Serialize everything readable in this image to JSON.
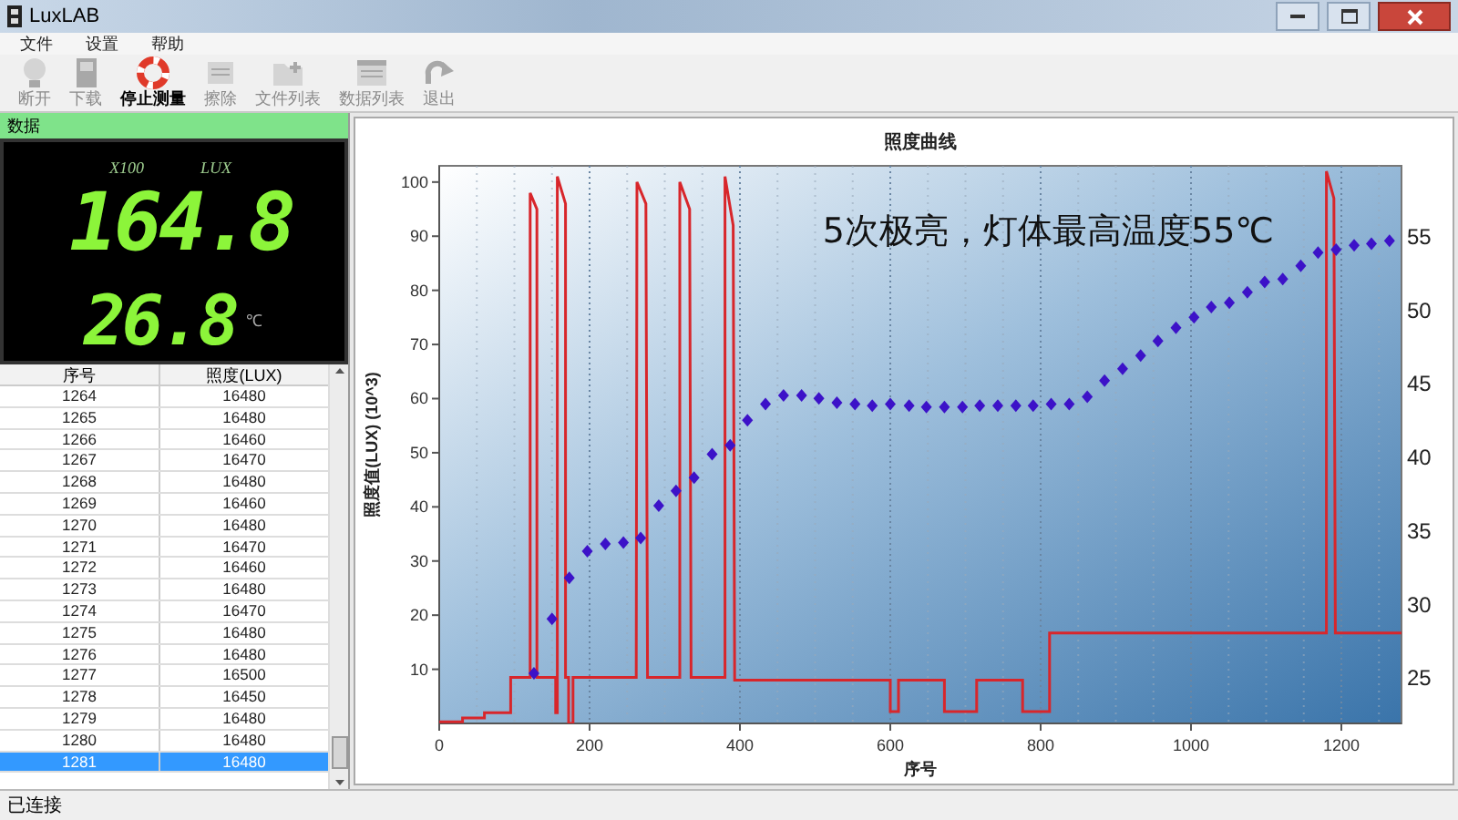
{
  "window": {
    "title": "LuxLAB"
  },
  "menu": [
    "文件",
    "设置",
    "帮助"
  ],
  "toolbar": [
    {
      "label": "断开",
      "disabled": true
    },
    {
      "label": "下载",
      "disabled": true
    },
    {
      "label": "停止测量",
      "disabled": false
    },
    {
      "label": "擦除",
      "disabled": true
    },
    {
      "label": "文件列表",
      "disabled": true
    },
    {
      "label": "数据列表",
      "disabled": true
    },
    {
      "label": "退出",
      "disabled": true
    }
  ],
  "data_panel": {
    "title": "数据",
    "display": {
      "multiplier": "X100",
      "unit": "LUX",
      "lux": "164.8",
      "temperature": "26.8",
      "temperature_unit": "℃"
    },
    "table": {
      "columns": [
        "序号",
        "照度(LUX)"
      ],
      "rows": [
        {
          "cells": [
            "1264",
            "16480"
          ],
          "selected": false
        },
        {
          "cells": [
            "1265",
            "16480"
          ],
          "selected": false
        },
        {
          "cells": [
            "1266",
            "16460"
          ],
          "selected": false
        },
        {
          "cells": [
            "1267",
            "16470"
          ],
          "selected": false
        },
        {
          "cells": [
            "1268",
            "16480"
          ],
          "selected": false
        },
        {
          "cells": [
            "1269",
            "16460"
          ],
          "selected": false
        },
        {
          "cells": [
            "1270",
            "16480"
          ],
          "selected": false
        },
        {
          "cells": [
            "1271",
            "16470"
          ],
          "selected": false
        },
        {
          "cells": [
            "1272",
            "16460"
          ],
          "selected": false
        },
        {
          "cells": [
            "1273",
            "16480"
          ],
          "selected": false
        },
        {
          "cells": [
            "1274",
            "16470"
          ],
          "selected": false
        },
        {
          "cells": [
            "1275",
            "16480"
          ],
          "selected": false
        },
        {
          "cells": [
            "1276",
            "16480"
          ],
          "selected": false
        },
        {
          "cells": [
            "1277",
            "16500"
          ],
          "selected": false
        },
        {
          "cells": [
            "1278",
            "16450"
          ],
          "selected": false
        },
        {
          "cells": [
            "1279",
            "16480"
          ],
          "selected": false
        },
        {
          "cells": [
            "1280",
            "16480"
          ],
          "selected": false
        },
        {
          "cells": [
            "1281",
            "16480"
          ],
          "selected": true
        }
      ]
    }
  },
  "chart_panel": {
    "chart_data": {
      "type": "line",
      "title": "照度曲线",
      "xlabel": "序号",
      "ylabel": "照度值(LUX)  (10^3)",
      "grid": true,
      "xlim": [
        0,
        1280
      ],
      "ylim": [
        0,
        103
      ],
      "xticks": [
        0,
        200,
        400,
        600,
        800,
        1000,
        1200
      ],
      "yticks": [
        10,
        20,
        30,
        40,
        50,
        60,
        70,
        80,
        90,
        100
      ],
      "y2lim": [
        21.8,
        59.7
      ],
      "y2ticks": [
        25,
        30,
        35,
        40,
        45,
        50,
        55
      ],
      "series": [
        {
          "type": "line",
          "color": "#d8262b",
          "x": [
            0,
            31,
            31,
            60,
            60,
            95,
            95,
            121,
            121,
            130,
            130,
            155,
            155,
            157,
            157,
            168,
            168,
            172,
            172,
            178,
            178,
            262,
            263,
            275,
            277,
            320,
            320,
            333,
            335,
            380,
            380,
            391,
            393,
            600,
            600,
            611,
            611,
            672,
            672,
            715,
            715,
            776,
            776,
            812,
            812,
            1180,
            1180,
            1190,
            1192,
            1280
          ],
          "values": [
            0.3,
            0.3,
            1,
            1,
            2,
            2,
            8.5,
            8.5,
            98,
            95,
            8.5,
            8.5,
            2,
            2,
            101,
            96,
            8.5,
            8.5,
            0,
            0,
            8.5,
            8.5,
            100,
            96,
            8.5,
            8.5,
            100,
            95,
            8.5,
            8.5,
            101,
            92,
            8,
            8,
            2.2,
            2.2,
            8,
            8,
            2.2,
            2.2,
            8,
            8,
            2.2,
            2.2,
            16.7,
            16.7,
            102,
            97,
            16.7,
            16.7
          ]
        },
        {
          "type": "scatter",
          "axis": "y2",
          "color": "#3c12c8",
          "x": [
            126,
            150,
            173,
            197,
            221,
            245,
            268,
            292,
            315,
            339,
            363,
            387,
            410,
            434,
            458,
            482,
            505,
            529,
            553,
            576,
            600,
            625,
            648,
            672,
            696,
            719,
            743,
            767,
            790,
            814,
            838,
            862,
            885,
            909,
            933,
            956,
            980,
            1004,
            1027,
            1051,
            1075,
            1098,
            1122,
            1146,
            1169,
            1193,
            1217,
            1240,
            1264
          ],
          "values": [
            25.2,
            28.9,
            31.7,
            33.5,
            34.0,
            34.1,
            34.4,
            36.6,
            37.6,
            38.5,
            40.1,
            40.7,
            42.4,
            43.5,
            44.1,
            44.1,
            43.9,
            43.6,
            43.5,
            43.4,
            43.5,
            43.4,
            43.3,
            43.3,
            43.3,
            43.4,
            43.4,
            43.4,
            43.4,
            43.5,
            43.5,
            44.0,
            45.1,
            45.9,
            46.8,
            47.8,
            48.7,
            49.4,
            50.1,
            50.4,
            51.1,
            51.8,
            52.0,
            52.9,
            53.8,
            54.0,
            54.3,
            54.4,
            54.6
          ]
        }
      ],
      "annotations": [
        "5次极亮，灯体最高温度55℃"
      ]
    }
  },
  "status_bar": "已连接"
}
